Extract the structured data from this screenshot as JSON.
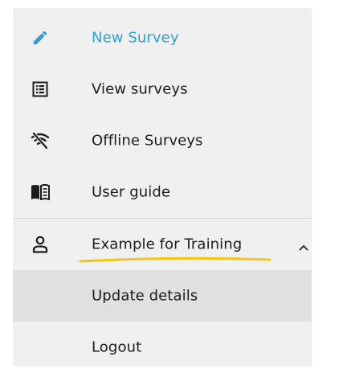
{
  "menu": {
    "items": [
      {
        "label": "New Survey",
        "icon": "pencil-icon"
      },
      {
        "label": "View surveys",
        "icon": "list-icon"
      },
      {
        "label": "Offline Surveys",
        "icon": "wifi-off-icon"
      },
      {
        "label": "User guide",
        "icon": "book-icon"
      }
    ],
    "account": {
      "label": "Example for Training",
      "icon": "person-icon",
      "expanded": true
    },
    "submenu": [
      {
        "label": "Update details"
      },
      {
        "label": "Logout"
      }
    ]
  },
  "colors": {
    "accent": "#2c9fd8",
    "panel_bg": "#f0f0f0",
    "highlight_bg": "#e0e0e0",
    "annotation": "#f5c518",
    "text": "#1c1c1c"
  }
}
